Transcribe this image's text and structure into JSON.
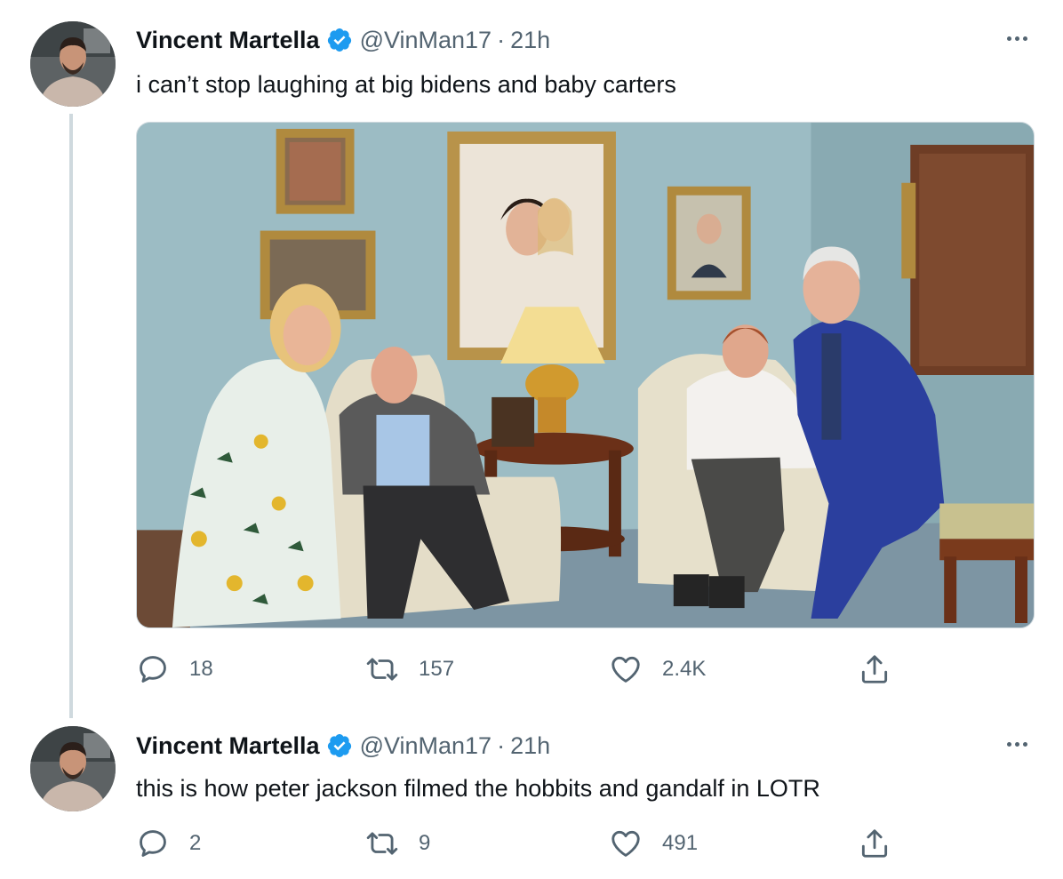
{
  "tweets": [
    {
      "author": {
        "name": "Vincent Martella",
        "handle": "@VinMan17"
      },
      "time": "21h",
      "text": "i can’t stop laughing at big bidens and baby carters",
      "stats": {
        "replies": "18",
        "retweets": "157",
        "likes": "2.4K"
      },
      "has_media": true
    },
    {
      "author": {
        "name": "Vincent Martella",
        "handle": "@VinMan17"
      },
      "time": "21h",
      "text": "this is how peter jackson filmed the hobbits and gandalf in LOTR",
      "stats": {
        "replies": "2",
        "retweets": "9",
        "likes": "491"
      },
      "has_media": false
    }
  ],
  "separator": "·",
  "icons": {
    "verified": "verified-badge-icon",
    "more": "more-options-icon",
    "reply": "reply-icon",
    "retweet": "retweet-icon",
    "like": "like-icon",
    "share": "share-icon"
  },
  "colors": {
    "text_primary": "#0f1419",
    "text_secondary": "#536471",
    "verified": "#1d9bf0",
    "thread_line": "#cfd9de"
  }
}
